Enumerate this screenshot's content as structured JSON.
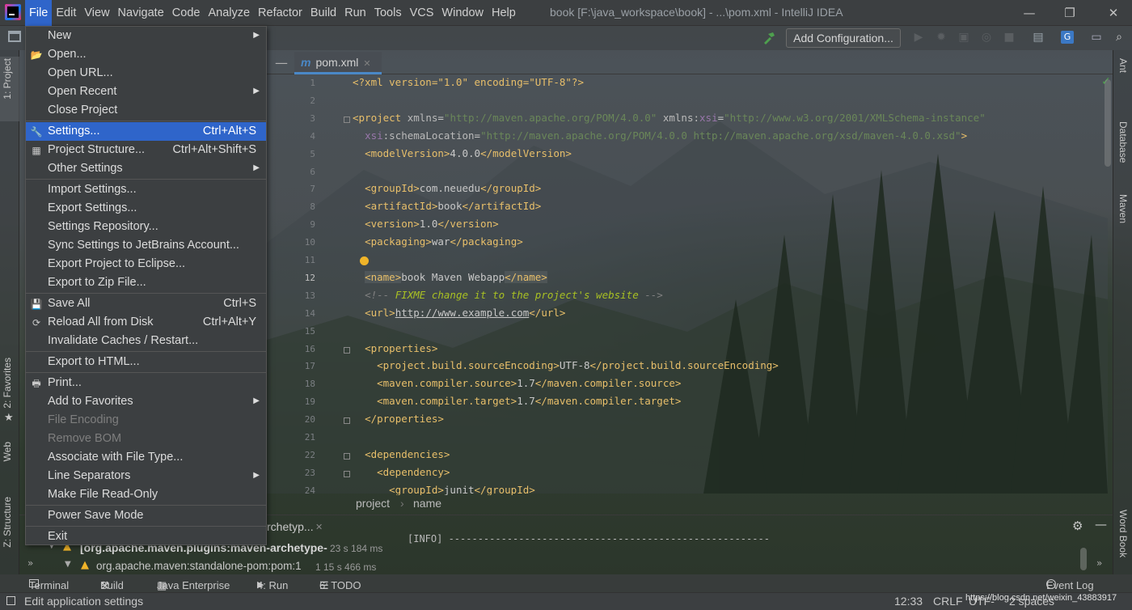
{
  "window": {
    "title": "book [F:\\java_workspace\\book] - ...\\pom.xml - IntelliJ IDEA",
    "minimize_glyph": "—",
    "restore_glyph": "❐",
    "close_glyph": "✕"
  },
  "menubar": [
    "File",
    "Edit",
    "View",
    "Navigate",
    "Code",
    "Analyze",
    "Refactor",
    "Build",
    "Run",
    "Tools",
    "VCS",
    "Window",
    "Help"
  ],
  "toolbar": {
    "add_configuration": "Add Configuration..."
  },
  "left_tabs": {
    "project": "1: Project",
    "favorites": "2: Favorites",
    "web": "Web",
    "structure": "Z: Structure"
  },
  "right_tabs": {
    "ant": "Ant",
    "database": "Database",
    "maven": "Maven",
    "wordbook": "Word Book"
  },
  "editor": {
    "tab_label": "pom.xml",
    "tab_icon": "m",
    "lines": [
      {
        "n": "1",
        "html": "<span class='c-t'>&lt;?xml version=\"1.0\" encoding=\"UTF-8\"?&gt;</span>"
      },
      {
        "n": "2",
        "html": ""
      },
      {
        "n": "3",
        "html": "<span class='c-t'>&lt;project</span> <span class='c-a'>xmlns</span>=<span class='c-v'>\"http://maven.apache.org/POM/4.0.0\"</span> <span class='c-a'>xmlns:</span><span class='c-n'>xsi</span>=<span class='c-v'>\"http://www.w3.org/2001/XMLSchema-instance\"</span>"
      },
      {
        "n": "4",
        "html": "  <span class='c-n'>xsi</span><span class='c-a'>:schemaLocation</span>=<span class='c-v'>\"http://maven.apache.org/POM/4.0.0 http://maven.apache.org/xsd/maven-4.0.0.xsd\"</span><span class='c-t'>&gt;</span>"
      },
      {
        "n": "5",
        "html": "  <span class='c-t'>&lt;modelVersion&gt;</span>4.0.0<span class='c-t'>&lt;/modelVersion&gt;</span>"
      },
      {
        "n": "6",
        "html": ""
      },
      {
        "n": "7",
        "html": "  <span class='c-t'>&lt;groupId&gt;</span>com.neuedu<span class='c-t'>&lt;/groupId&gt;</span>"
      },
      {
        "n": "8",
        "html": "  <span class='c-t'>&lt;artifactId&gt;</span>book<span class='c-t'>&lt;/artifactId&gt;</span>"
      },
      {
        "n": "9",
        "html": "  <span class='c-t'>&lt;version&gt;</span>1.0<span class='c-t'>&lt;/version&gt;</span>"
      },
      {
        "n": "10",
        "html": "  <span class='c-t'>&lt;packaging&gt;</span>war<span class='c-t'>&lt;/packaging&gt;</span>"
      },
      {
        "n": "11",
        "html": ""
      },
      {
        "n": "12",
        "html": "  <span class='c-t hl'>&lt;name&gt;</span>book Maven Webapp<span class='c-t hl'>&lt;/name&gt;</span>"
      },
      {
        "n": "13",
        "html": "  <span class='c-com'>&lt;!-- </span><span class='c-fx'>FIXME change it to the project's website</span><span class='c-com'> --&gt;</span>"
      },
      {
        "n": "14",
        "html": "  <span class='c-t'>&lt;url&gt;</span><u>http://www.example.com</u><span class='c-t'>&lt;/url&gt;</span>"
      },
      {
        "n": "15",
        "html": ""
      },
      {
        "n": "16",
        "html": "  <span class='c-t'>&lt;properties&gt;</span>"
      },
      {
        "n": "17",
        "html": "    <span class='c-t'>&lt;project.build.sourceEncoding&gt;</span>UTF-8<span class='c-t'>&lt;/project.build.sourceEncoding&gt;</span>"
      },
      {
        "n": "18",
        "html": "    <span class='c-t'>&lt;maven.compiler.source&gt;</span>1.7<span class='c-t'>&lt;/maven.compiler.source&gt;</span>"
      },
      {
        "n": "19",
        "html": "    <span class='c-t'>&lt;maven.compiler.target&gt;</span>1.7<span class='c-t'>&lt;/maven.compiler.target&gt;</span>"
      },
      {
        "n": "20",
        "html": "  <span class='c-t'>&lt;/properties&gt;</span>"
      },
      {
        "n": "21",
        "html": ""
      },
      {
        "n": "22",
        "html": "  <span class='c-t'>&lt;dependencies&gt;</span>"
      },
      {
        "n": "23",
        "html": "    <span class='c-t'>&lt;dependency&gt;</span>"
      },
      {
        "n": "24",
        "html": "      <span class='c-t'>&lt;groupId&gt;</span>junit<span class='c-t'>&lt;/groupId&gt;</span>"
      }
    ],
    "breadcrumb": [
      "project",
      "name"
    ],
    "breadcrumb_sep": "›"
  },
  "run_panel": {
    "tab_label": "rchetyp...",
    "tree": [
      {
        "label": "[org.apache.maven.plugins:maven-archetype-p",
        "time": "23 s 184 ms"
      },
      {
        "label": "org.apache.maven:standalone-pom:pom:1",
        "time": "1  15 s 466 ms"
      }
    ],
    "console": "[INFO] -------------------------------------------------------"
  },
  "bottom_tools": [
    "Terminal",
    "Build",
    "Java Enterprise",
    "4: Run",
    "6: TODO"
  ],
  "event_log": "Event Log",
  "status": {
    "message": "Edit application settings",
    "position": "12:33",
    "line_sep": "CRLF",
    "encoding": "UTF-",
    "indent": "2 spaces",
    "watermark": "https://blog.csdn.net/weixin_43883917"
  },
  "file_menu": {
    "items": [
      {
        "label": "New",
        "shortcut": "",
        "submenu": true,
        "icon": "",
        "state": "normal"
      },
      {
        "label": "Open...",
        "shortcut": "",
        "submenu": false,
        "icon": "folder-open-icon",
        "state": "normal"
      },
      {
        "label": "Open URL...",
        "shortcut": "",
        "submenu": false,
        "icon": "",
        "state": "normal"
      },
      {
        "label": "Open Recent",
        "shortcut": "",
        "submenu": true,
        "icon": "",
        "state": "normal"
      },
      {
        "label": "Close Project",
        "shortcut": "",
        "submenu": false,
        "icon": "",
        "state": "normal"
      },
      {
        "label": "Settings...",
        "shortcut": "Ctrl+Alt+S",
        "submenu": false,
        "icon": "wrench-icon",
        "state": "selected"
      },
      {
        "label": "Project Structure...",
        "shortcut": "Ctrl+Alt+Shift+S",
        "submenu": false,
        "icon": "project-structure-icon",
        "state": "normal"
      },
      {
        "label": "Other Settings",
        "shortcut": "",
        "submenu": true,
        "icon": "",
        "state": "normal"
      },
      {
        "label": "Import Settings...",
        "shortcut": "",
        "submenu": false,
        "icon": "",
        "state": "normal"
      },
      {
        "label": "Export Settings...",
        "shortcut": "",
        "submenu": false,
        "icon": "",
        "state": "normal"
      },
      {
        "label": "Settings Repository...",
        "shortcut": "",
        "submenu": false,
        "icon": "",
        "state": "normal"
      },
      {
        "label": "Sync Settings to JetBrains Account...",
        "shortcut": "",
        "submenu": false,
        "icon": "",
        "state": "normal"
      },
      {
        "label": "Export Project to Eclipse...",
        "shortcut": "",
        "submenu": false,
        "icon": "",
        "state": "normal"
      },
      {
        "label": "Export to Zip File...",
        "shortcut": "",
        "submenu": false,
        "icon": "",
        "state": "normal"
      },
      {
        "label": "Save All",
        "shortcut": "Ctrl+S",
        "submenu": false,
        "icon": "save-icon",
        "state": "normal"
      },
      {
        "label": "Reload All from Disk",
        "shortcut": "Ctrl+Alt+Y",
        "submenu": false,
        "icon": "reload-icon",
        "state": "normal"
      },
      {
        "label": "Invalidate Caches / Restart...",
        "shortcut": "",
        "submenu": false,
        "icon": "",
        "state": "normal"
      },
      {
        "label": "Export to HTML...",
        "shortcut": "",
        "submenu": false,
        "icon": "",
        "state": "normal"
      },
      {
        "label": "Print...",
        "shortcut": "",
        "submenu": false,
        "icon": "print-icon",
        "state": "normal"
      },
      {
        "label": "Add to Favorites",
        "shortcut": "",
        "submenu": true,
        "icon": "",
        "state": "normal"
      },
      {
        "label": "File Encoding",
        "shortcut": "",
        "submenu": false,
        "icon": "",
        "state": "disabled"
      },
      {
        "label": "Remove BOM",
        "shortcut": "",
        "submenu": false,
        "icon": "",
        "state": "disabled"
      },
      {
        "label": "Associate with File Type...",
        "shortcut": "",
        "submenu": false,
        "icon": "",
        "state": "normal"
      },
      {
        "label": "Line Separators",
        "shortcut": "",
        "submenu": true,
        "icon": "",
        "state": "normal"
      },
      {
        "label": "Make File Read-Only",
        "shortcut": "",
        "submenu": false,
        "icon": "",
        "state": "normal"
      },
      {
        "label": "Power Save Mode",
        "shortcut": "",
        "submenu": false,
        "icon": "",
        "state": "normal"
      },
      {
        "label": "Exit",
        "shortcut": "",
        "submenu": false,
        "icon": "",
        "state": "normal"
      }
    ]
  },
  "colors": {
    "accent": "#2f65ca",
    "tab_underline": "#4a88c7",
    "xml_tag": "#e8bf6a",
    "xml_value": "#6a8759",
    "namespace": "#9876aa"
  }
}
